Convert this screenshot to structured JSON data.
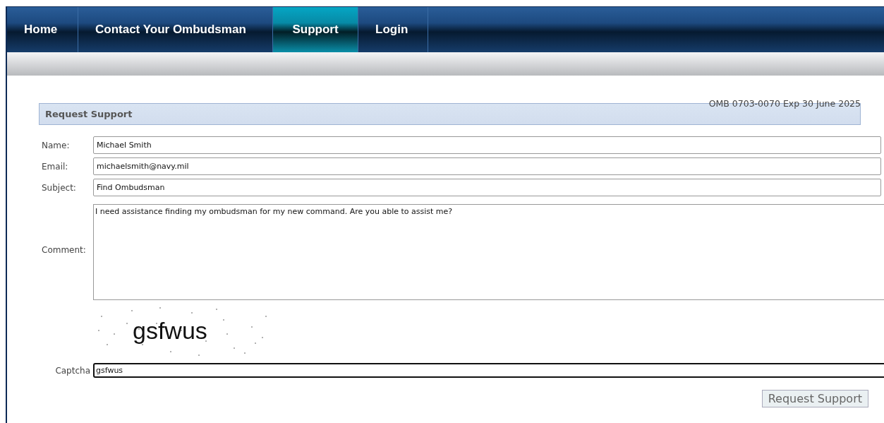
{
  "nav": [
    {
      "label": "Home",
      "selected": false
    },
    {
      "label": "Contact Your Ombudsman",
      "selected": false
    },
    {
      "label": "Support",
      "selected": true
    },
    {
      "label": "Login",
      "selected": false
    }
  ],
  "omb_notice": "OMB 0703-0070 Exp 30 June 2025",
  "panel_title": "Request Support",
  "fields": [
    {
      "label": "Name:",
      "kind": "text",
      "value": "Michael Smith"
    },
    {
      "label": "Email:",
      "kind": "text",
      "value": "michaelsmith@navy.mil"
    },
    {
      "label": "Subject:",
      "kind": "text",
      "value": "Find Ombudsman"
    },
    {
      "label": "Comment:",
      "kind": "textarea",
      "value": "I need assistance finding my ombudsman for my new command. Are you able to assist me?"
    }
  ],
  "captcha": {
    "image_text": "gsfwus",
    "label": "Captcha",
    "value": "gsfwus"
  },
  "submit": "Request Support"
}
